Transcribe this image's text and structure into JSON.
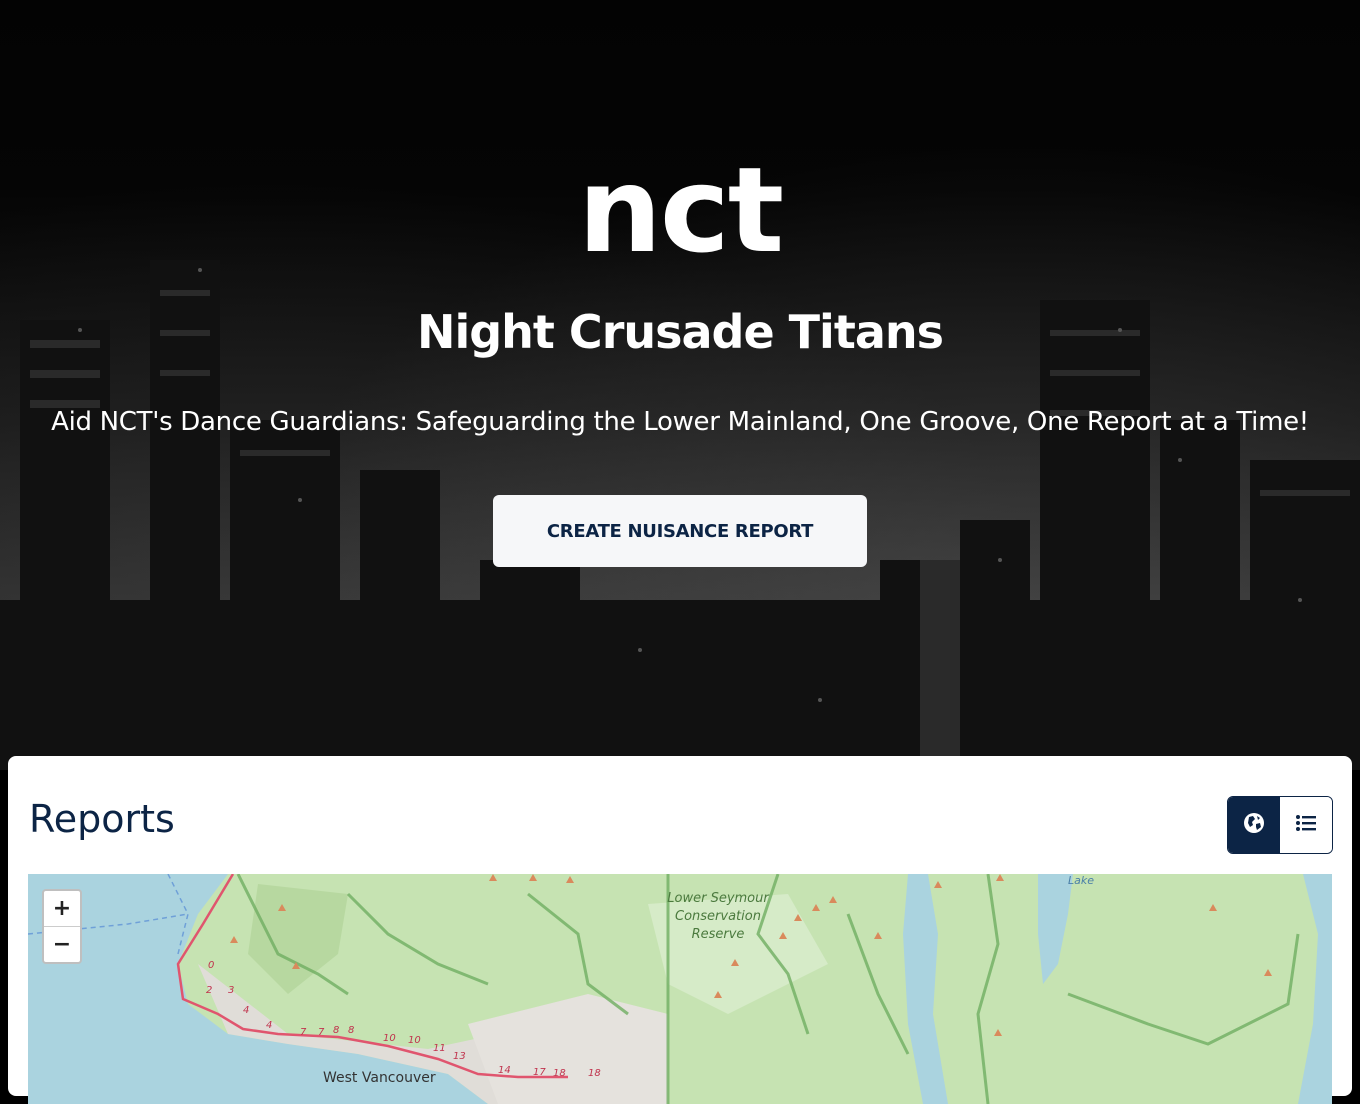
{
  "hero": {
    "logo": "nct",
    "title": "Night Crusade Titans",
    "tagline": "Aid NCT's Dance Guardians: Safeguarding the Lower Mainland, One Groove, One Report at a Time!",
    "cta_label": "CREATE NUISANCE REPORT"
  },
  "reports": {
    "title": "Reports",
    "view_toggle": [
      {
        "icon": "globe-icon",
        "active": true
      },
      {
        "icon": "list-icon",
        "active": false
      }
    ]
  },
  "map": {
    "zoom_in": "+",
    "zoom_out": "−",
    "labels": {
      "park_line1": "Lower Seymour",
      "park_line2": "Conservation",
      "park_line3": "Reserve",
      "city": "West Vancouver",
      "lake": "Lake"
    },
    "route_markers": [
      "0",
      "2",
      "3",
      "4",
      "4",
      "7",
      "7",
      "8",
      "8",
      "10",
      "10",
      "11",
      "13",
      "14",
      "17",
      "18",
      "18"
    ]
  },
  "colors": {
    "brand_navy": "#0c2445",
    "map_park": "#c6e3b2",
    "map_water": "#aad3df",
    "route": "#e0556e"
  }
}
